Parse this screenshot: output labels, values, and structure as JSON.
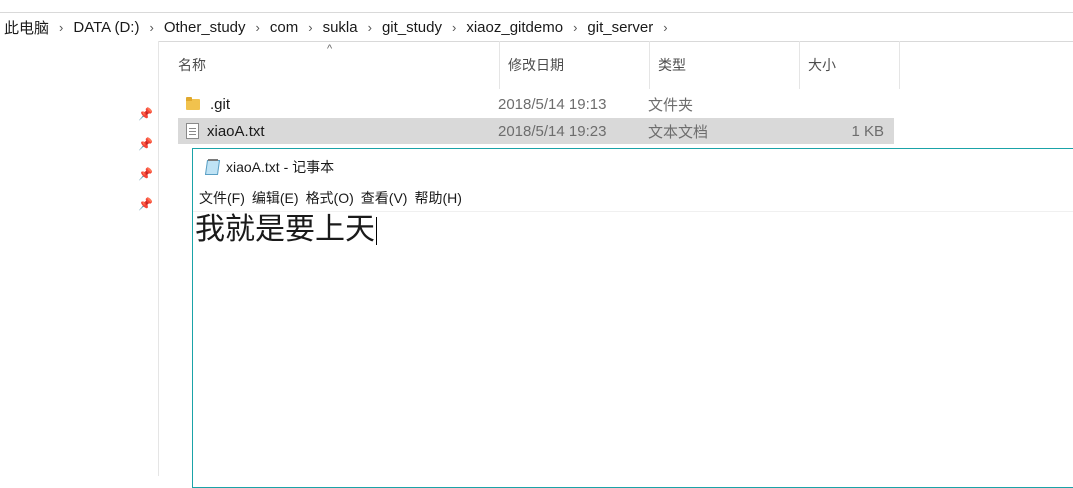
{
  "breadcrumb": {
    "items": [
      "此电脑",
      "DATA (D:)",
      "Other_study",
      "com",
      "sukla",
      "git_study",
      "xiaoz_gitdemo",
      "git_server"
    ],
    "separator": "›"
  },
  "columns": {
    "name": "名称",
    "date": "修改日期",
    "type": "类型",
    "size": "大小",
    "sort_indicator": "^"
  },
  "files": [
    {
      "name": ".git",
      "date": "2018/5/14 19:13",
      "type": "文件夹",
      "size": "",
      "icon": "folder-icon"
    },
    {
      "name": "xiaoA.txt",
      "date": "2018/5/14 19:23",
      "type": "文本文档",
      "size": "1 KB",
      "icon": "text-file-icon",
      "selected": true
    }
  ],
  "nav": {
    "pins": [
      "📌",
      "📌",
      "📌",
      "📌"
    ]
  },
  "notepad": {
    "title": "xiaoA.txt - 记事本",
    "menu": [
      "文件(F)",
      "编辑(E)",
      "格式(O)",
      "查看(V)",
      "帮助(H)"
    ],
    "content": "我就是要上天"
  },
  "colors": {
    "accent_border": "#1aa3a8",
    "selection": "#d9d9d9",
    "folder": "#f1c24d"
  }
}
